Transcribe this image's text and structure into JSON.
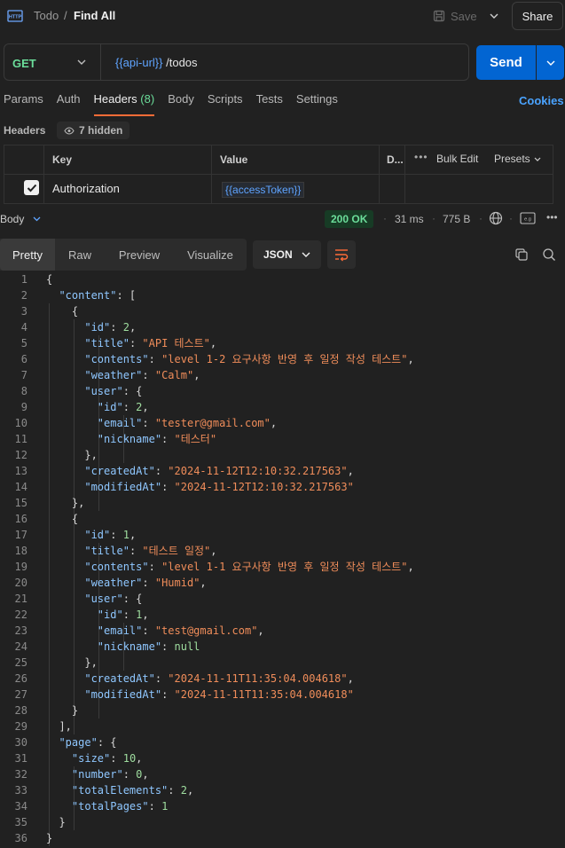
{
  "app": {
    "breadcrumb_parent": "Todo",
    "breadcrumb_sep": "/",
    "request_title": "Find All",
    "save_label": "Save",
    "share_label": "Share"
  },
  "request": {
    "method": "GET",
    "url_var": "{{api-url}}",
    "url_path": " /todos",
    "send_label": "Send"
  },
  "tabs": [
    {
      "label": "Params"
    },
    {
      "label": "Auth"
    },
    {
      "label": "Headers",
      "count": " (8)",
      "active": true
    },
    {
      "label": "Body"
    },
    {
      "label": "Scripts"
    },
    {
      "label": "Tests"
    },
    {
      "label": "Settings"
    }
  ],
  "cookies_label": "Cookies",
  "headers_section": {
    "label": "Headers",
    "hidden_label": "7 hidden",
    "columns": {
      "key": "Key",
      "value": "Value",
      "description": "D..."
    },
    "bulk_edit": "Bulk Edit",
    "presets": "Presets",
    "rows": [
      {
        "key": "Authorization",
        "value": "{{accessToken}}",
        "checked": true
      }
    ]
  },
  "response": {
    "body_label": "Body",
    "status": "200 OK",
    "time": "31 ms",
    "size": "775 B",
    "view_tabs": [
      "Pretty",
      "Raw",
      "Preview",
      "Visualize"
    ],
    "format": "JSON"
  },
  "code_lines": [
    [
      [
        "p",
        "{"
      ]
    ],
    [
      [
        "p",
        "  "
      ],
      [
        "k",
        "\"content\""
      ],
      [
        "p",
        ": ["
      ]
    ],
    [
      [
        "p",
        "    {"
      ]
    ],
    [
      [
        "p",
        "      "
      ],
      [
        "k",
        "\"id\""
      ],
      [
        "p",
        ": "
      ],
      [
        "n",
        "2"
      ],
      [
        "p",
        ","
      ]
    ],
    [
      [
        "p",
        "      "
      ],
      [
        "k",
        "\"title\""
      ],
      [
        "p",
        ": "
      ],
      [
        "s",
        "\"API 테스트\""
      ],
      [
        "p",
        ","
      ]
    ],
    [
      [
        "p",
        "      "
      ],
      [
        "k",
        "\"contents\""
      ],
      [
        "p",
        ": "
      ],
      [
        "s",
        "\"level 1-2 요구사항 반영 후 일정 작성 테스트\""
      ],
      [
        "p",
        ","
      ]
    ],
    [
      [
        "p",
        "      "
      ],
      [
        "k",
        "\"weather\""
      ],
      [
        "p",
        ": "
      ],
      [
        "s",
        "\"Calm\""
      ],
      [
        "p",
        ","
      ]
    ],
    [
      [
        "p",
        "      "
      ],
      [
        "k",
        "\"user\""
      ],
      [
        "p",
        ": {"
      ]
    ],
    [
      [
        "p",
        "        "
      ],
      [
        "k",
        "\"id\""
      ],
      [
        "p",
        ": "
      ],
      [
        "n",
        "2"
      ],
      [
        "p",
        ","
      ]
    ],
    [
      [
        "p",
        "        "
      ],
      [
        "k",
        "\"email\""
      ],
      [
        "p",
        ": "
      ],
      [
        "s",
        "\"tester@gmail.com\""
      ],
      [
        "p",
        ","
      ]
    ],
    [
      [
        "p",
        "        "
      ],
      [
        "k",
        "\"nickname\""
      ],
      [
        "p",
        ": "
      ],
      [
        "s",
        "\"테스터\""
      ]
    ],
    [
      [
        "p",
        "      },"
      ]
    ],
    [
      [
        "p",
        "      "
      ],
      [
        "k",
        "\"createdAt\""
      ],
      [
        "p",
        ": "
      ],
      [
        "s",
        "\"2024-11-12T12:10:32.217563\""
      ],
      [
        "p",
        ","
      ]
    ],
    [
      [
        "p",
        "      "
      ],
      [
        "k",
        "\"modifiedAt\""
      ],
      [
        "p",
        ": "
      ],
      [
        "s",
        "\"2024-11-12T12:10:32.217563\""
      ]
    ],
    [
      [
        "p",
        "    },"
      ]
    ],
    [
      [
        "p",
        "    {"
      ]
    ],
    [
      [
        "p",
        "      "
      ],
      [
        "k",
        "\"id\""
      ],
      [
        "p",
        ": "
      ],
      [
        "n",
        "1"
      ],
      [
        "p",
        ","
      ]
    ],
    [
      [
        "p",
        "      "
      ],
      [
        "k",
        "\"title\""
      ],
      [
        "p",
        ": "
      ],
      [
        "s",
        "\"테스트 일정\""
      ],
      [
        "p",
        ","
      ]
    ],
    [
      [
        "p",
        "      "
      ],
      [
        "k",
        "\"contents\""
      ],
      [
        "p",
        ": "
      ],
      [
        "s",
        "\"level 1-1 요구사항 반영 후 일정 작성 테스트\""
      ],
      [
        "p",
        ","
      ]
    ],
    [
      [
        "p",
        "      "
      ],
      [
        "k",
        "\"weather\""
      ],
      [
        "p",
        ": "
      ],
      [
        "s",
        "\"Humid\""
      ],
      [
        "p",
        ","
      ]
    ],
    [
      [
        "p",
        "      "
      ],
      [
        "k",
        "\"user\""
      ],
      [
        "p",
        ": {"
      ]
    ],
    [
      [
        "p",
        "        "
      ],
      [
        "k",
        "\"id\""
      ],
      [
        "p",
        ": "
      ],
      [
        "n",
        "1"
      ],
      [
        "p",
        ","
      ]
    ],
    [
      [
        "p",
        "        "
      ],
      [
        "k",
        "\"email\""
      ],
      [
        "p",
        ": "
      ],
      [
        "s",
        "\"test@gmail.com\""
      ],
      [
        "p",
        ","
      ]
    ],
    [
      [
        "p",
        "        "
      ],
      [
        "k",
        "\"nickname\""
      ],
      [
        "p",
        ": "
      ],
      [
        "n",
        "null"
      ]
    ],
    [
      [
        "p",
        "      },"
      ]
    ],
    [
      [
        "p",
        "      "
      ],
      [
        "k",
        "\"createdAt\""
      ],
      [
        "p",
        ": "
      ],
      [
        "s",
        "\"2024-11-11T11:35:04.004618\""
      ],
      [
        "p",
        ","
      ]
    ],
    [
      [
        "p",
        "      "
      ],
      [
        "k",
        "\"modifiedAt\""
      ],
      [
        "p",
        ": "
      ],
      [
        "s",
        "\"2024-11-11T11:35:04.004618\""
      ]
    ],
    [
      [
        "p",
        "    }"
      ]
    ],
    [
      [
        "p",
        "  ],"
      ]
    ],
    [
      [
        "p",
        "  "
      ],
      [
        "k",
        "\"page\""
      ],
      [
        "p",
        ": {"
      ]
    ],
    [
      [
        "p",
        "    "
      ],
      [
        "k",
        "\"size\""
      ],
      [
        "p",
        ": "
      ],
      [
        "n",
        "10"
      ],
      [
        "p",
        ","
      ]
    ],
    [
      [
        "p",
        "    "
      ],
      [
        "k",
        "\"number\""
      ],
      [
        "p",
        ": "
      ],
      [
        "n",
        "0"
      ],
      [
        "p",
        ","
      ]
    ],
    [
      [
        "p",
        "    "
      ],
      [
        "k",
        "\"totalElements\""
      ],
      [
        "p",
        ": "
      ],
      [
        "n",
        "2"
      ],
      [
        "p",
        ","
      ]
    ],
    [
      [
        "p",
        "    "
      ],
      [
        "k",
        "\"totalPages\""
      ],
      [
        "p",
        ": "
      ],
      [
        "n",
        "1"
      ]
    ],
    [
      [
        "p",
        "  }"
      ]
    ],
    [
      [
        "p",
        "}"
      ]
    ]
  ]
}
